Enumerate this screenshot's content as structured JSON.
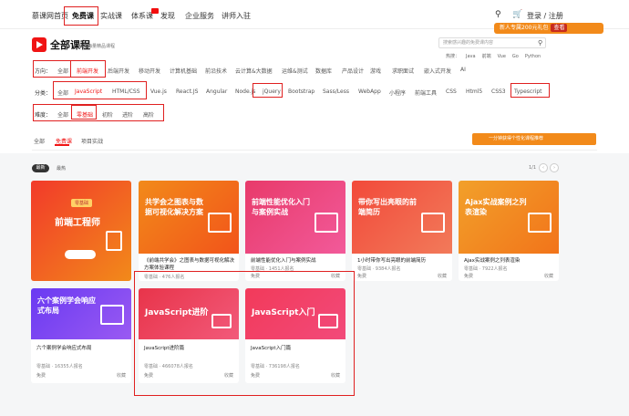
{
  "nav": {
    "items": [
      "慕课网首页",
      "免费课",
      "实战课",
      "体系课",
      "发现",
      "企业服务",
      "讲师入驻"
    ],
    "login": "登录 / 注册",
    "promo": "新人专属200元礼包",
    "promo_chip": "查看"
  },
  "header": {
    "title": "全部课程",
    "subtitle": "精挑海量精品课程",
    "search_placeholder": "搜索感兴趣的免费课内容",
    "hot_label": "热搜：",
    "hot_words": [
      "Java",
      "前端",
      "Vue",
      "Go",
      "Python"
    ]
  },
  "filters": {
    "direction_label": "方向：",
    "direction_options": [
      "全部",
      "前端开发",
      "后端开发",
      "移动开发",
      "计算机基础",
      "前沿技术",
      "云计算&大数据",
      "运维&测试",
      "数据库",
      "产品设计",
      "游戏",
      "求职面试",
      "嵌入式开发",
      "AI"
    ],
    "category_label": "分类：",
    "category_options": [
      "全部",
      "JavaScript",
      "HTML/CSS",
      "Vue.js",
      "React.JS",
      "Angular",
      "Node.js",
      "jQuery",
      "Bootstrap",
      "Sass/Less",
      "WebApp",
      "小程序",
      "前端工具",
      "CSS",
      "Html5",
      "CSS3",
      "Typescript"
    ],
    "level_label": "难度：",
    "level_options": [
      "全部",
      "零基础",
      "初阶",
      "进阶",
      "高阶"
    ]
  },
  "tabs": [
    "全部",
    "免费课",
    "项目实战"
  ],
  "banner": "一分钟获得个性化课程推荐",
  "sort": {
    "options": [
      "最新",
      "最热"
    ],
    "pager": "1/1"
  },
  "colors": {
    "accent": "#f01414",
    "orange": "#f28a1a"
  },
  "cards": [
    {
      "thumb_title": "前端工程师",
      "thumb_tag": "零基础",
      "title": "",
      "level": "",
      "count": "",
      "price": "",
      "fav": ""
    },
    {
      "thumb_title": "共学会之图表与数据可视化解决方案",
      "title": "《前端共学会》之图表与数据可视化解决方案体验课程",
      "level": "零基础",
      "count": "476人报名",
      "price": "免费",
      "fav": "收藏"
    },
    {
      "thumb_title": "前端性能优化入门与案例实战",
      "title": "前端性能优化入门与案例实战",
      "level": "零基础",
      "count": "1451人报名",
      "price": "免费",
      "fav": "收藏"
    },
    {
      "thumb_title": "带你写出亮眼的前端简历",
      "title": "1小时带你写出亮眼的前端简历",
      "level": "零基础",
      "count": "9384人报名",
      "price": "免费",
      "fav": "收藏"
    },
    {
      "thumb_title": "Ajax实战案例之列表渲染",
      "title": "Ajax实战案例之列表渲染",
      "level": "零基础",
      "count": "7922人报名",
      "price": "免费",
      "fav": "收藏"
    },
    {
      "thumb_title": "六个案例学会响应式布局",
      "title": "六个案例学会响应式布局",
      "level": "零基础",
      "count": "16355人报名",
      "price": "免费",
      "fav": "收藏"
    },
    {
      "thumb_title": "JavaScript进阶",
      "title": "JavaScript进阶篇",
      "level": "零基础",
      "count": "466078人报名",
      "price": "免费",
      "fav": "收藏"
    },
    {
      "thumb_title": "JavaScript入门",
      "title": "JavaScript入门篇",
      "level": "零基础",
      "count": "736198人报名",
      "price": "免费",
      "fav": "收藏"
    }
  ]
}
